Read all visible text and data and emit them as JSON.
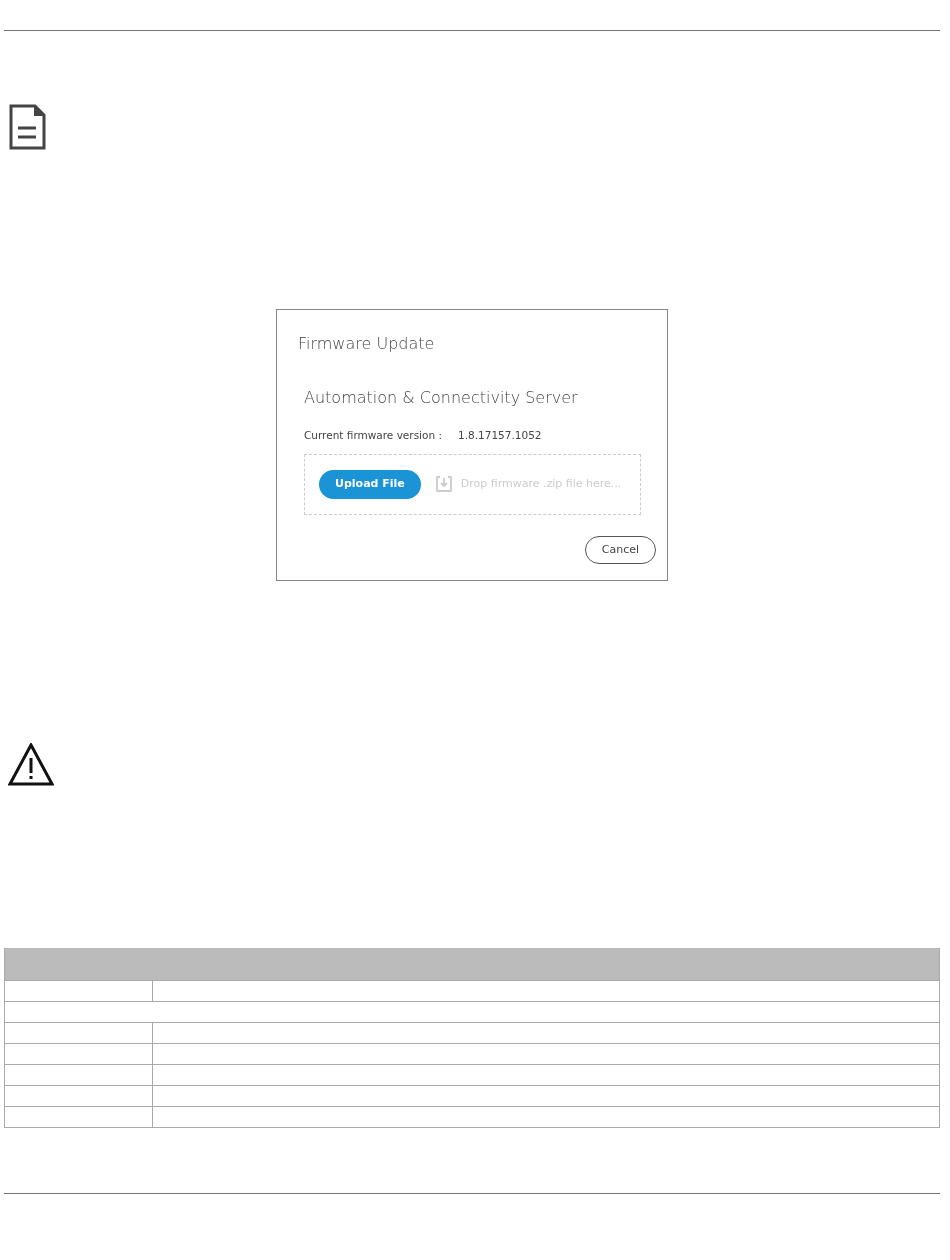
{
  "dialog": {
    "title": "Firmware Update",
    "device_name": "Automation & Connectivity Server",
    "version_label": "Current firmware version :",
    "version_value": "1.8.17157.1052",
    "upload_button": "Upload File",
    "drop_hint": "Drop firmware .zip file here...",
    "cancel_button": "Cancel"
  },
  "table": {
    "rows": [
      {
        "kind": "split"
      },
      {
        "kind": "full"
      },
      {
        "kind": "split"
      },
      {
        "kind": "split"
      },
      {
        "kind": "split"
      },
      {
        "kind": "split"
      },
      {
        "kind": "split"
      }
    ]
  }
}
